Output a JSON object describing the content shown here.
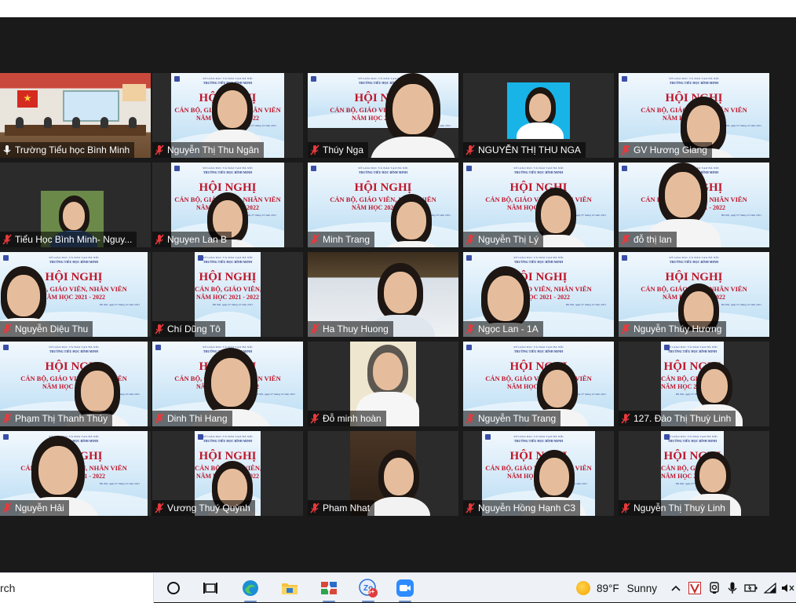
{
  "banner": {
    "ministry": "SỞ GIÁO DỤC VÀ ĐÀO TẠO HÀ NỘI",
    "school": "TRƯỜNG TIỂU HỌC BÌNH MINH",
    "heading": "HỘI NGHỊ",
    "sub": "CÁN BỘ, GIÁO VIÊN, NHÂN VIÊN",
    "year": "NĂM HỌC 2021 - 2022",
    "date": "Hà Nội, ngày 07 tháng 10 năm 2021"
  },
  "participants": [
    {
      "name": "Trường Tiểu học Bình Minh",
      "mic": "on",
      "active": true
    },
    {
      "name": "Nguyễn Thị Thu Ngân",
      "mic": "muted"
    },
    {
      "name": "Thúy Nga",
      "mic": "muted"
    },
    {
      "name": "NGUYỄN THỊ THU NGA",
      "mic": "muted"
    },
    {
      "name": "GV Hương Giang",
      "mic": "muted"
    },
    {
      "name": "Tiểu Học Bình Minh- Nguy...",
      "mic": "muted"
    },
    {
      "name": "Nguyen Lan B",
      "mic": "muted"
    },
    {
      "name": "Minh Trang",
      "mic": "muted"
    },
    {
      "name": "Nguyễn Thị Lý",
      "mic": "muted"
    },
    {
      "name": "đỗ thị lan",
      "mic": "muted"
    },
    {
      "name": "Nguyễn Diệu Thu",
      "mic": "muted"
    },
    {
      "name": "Chí Dũng Tô",
      "mic": "muted"
    },
    {
      "name": "Ha Thuy Huong",
      "mic": "muted"
    },
    {
      "name": "Ngọc Lan - 1A",
      "mic": "muted"
    },
    {
      "name": "Nguyễn Thúy Hương",
      "mic": "muted"
    },
    {
      "name": "Phạm Thị Thanh Thúy",
      "mic": "muted"
    },
    {
      "name": "Dinh Thi Hang",
      "mic": "muted"
    },
    {
      "name": "Đỗ minh hoàn",
      "mic": "muted"
    },
    {
      "name": "Nguyễn Thu Trang",
      "mic": "muted"
    },
    {
      "name": "127. Đào Thị Thuỳ Linh",
      "mic": "muted"
    },
    {
      "name": "Nguyễn Hải",
      "mic": "muted"
    },
    {
      "name": "Vương Thuý Quỳnh",
      "mic": "muted"
    },
    {
      "name": "Pham Nhat",
      "mic": "muted"
    },
    {
      "name": "Nguyễn Hồng Hạnh C3",
      "mic": "muted"
    },
    {
      "name": "Nguyễn Thị Thuỳ Linh",
      "mic": "muted"
    }
  ],
  "taskbar": {
    "search_text": "rch",
    "apps": [
      "task-view-icon",
      "edge-icon",
      "file-explorer-icon",
      "office-app-icon",
      "zalo-icon",
      "zoom-icon"
    ],
    "zalo_badge": "5+",
    "weather_temp": "89°F",
    "weather_desc": "Sunny",
    "colors": {
      "taskbar": "#eef2f7",
      "active_border": "#e6e04a",
      "muted_mic": "#e8393c",
      "banner_red": "#c0162b"
    }
  }
}
